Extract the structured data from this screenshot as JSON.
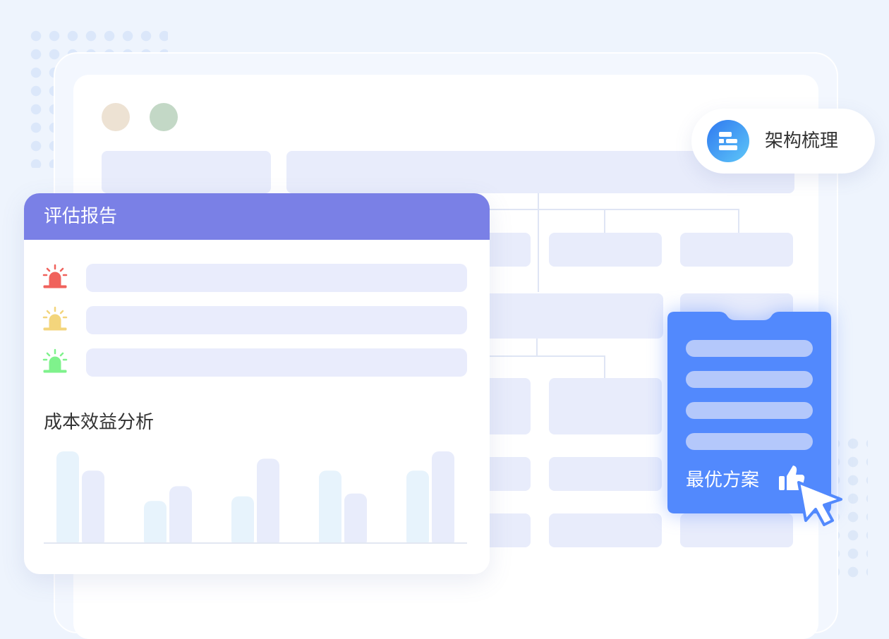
{
  "report": {
    "title": "评估报告",
    "alerts": [
      {
        "level": "high",
        "color": "#f0625c"
      },
      {
        "level": "medium",
        "color": "#f3d57c"
      },
      {
        "level": "low",
        "color": "#7ff28c"
      }
    ],
    "cost_benefit_title": "成本效益分析"
  },
  "pill": {
    "label": "架构梳理",
    "icon": "structure-icon"
  },
  "best_plan": {
    "label": "最优方案",
    "icon": "thumbs-up-icon"
  },
  "cursor": {
    "icon": "pointer-cursor-icon"
  },
  "window_dots": [
    "#ede2d3",
    "#c3d8c6"
  ],
  "colors": {
    "accent": "#7a80e6",
    "best_bg": "#5289fd",
    "block": "#e8ecfb"
  },
  "chart_data": {
    "type": "bar",
    "categories": [
      "",
      "",
      "",
      "",
      ""
    ],
    "series": [
      {
        "color": "#e7f3fc",
        "values": [
          100,
          46,
          51,
          79,
          79
        ]
      },
      {
        "color": "#e8ecfb",
        "values": [
          79,
          62,
          92,
          54,
          100
        ]
      }
    ],
    "ylim": [
      0,
      100
    ],
    "title": "",
    "xlabel": "",
    "ylabel": "",
    "grid": false,
    "baseline": true
  }
}
